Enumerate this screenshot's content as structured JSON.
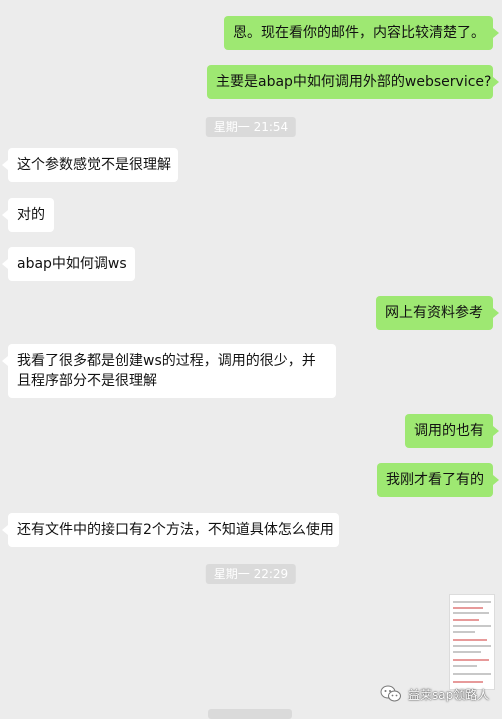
{
  "chat": {
    "messages": [
      {
        "side": "out",
        "text": "恩。现在看你的邮件，内容比较清楚了。"
      },
      {
        "side": "out",
        "text": "主要是abap中如何调用外部的webservice?"
      },
      {
        "type": "time",
        "text": "星期一 21:54"
      },
      {
        "side": "in",
        "text": "这个参数感觉不是很理解"
      },
      {
        "side": "in",
        "text": "对的"
      },
      {
        "side": "in",
        "text": "abap中如何调ws"
      },
      {
        "side": "out",
        "text": "网上有资料参考"
      },
      {
        "side": "in",
        "text": "我看了很多都是创建ws的过程，调用的很少，并且程序部分不是很理解"
      },
      {
        "side": "out",
        "text": "调用的也有"
      },
      {
        "side": "out",
        "text": "我刚才看了有的"
      },
      {
        "side": "in",
        "text": "还有文件中的接口有2个方法，不知道具体怎么使用"
      },
      {
        "type": "time",
        "text": "星期一 22:29"
      }
    ]
  },
  "watermark": {
    "icon": "wechat-icon",
    "text": "益莱sap领路人"
  },
  "colors": {
    "outgoing": "#9ee872",
    "incoming": "#ffffff",
    "background": "#ececec",
    "time_bg": "#dadada"
  }
}
